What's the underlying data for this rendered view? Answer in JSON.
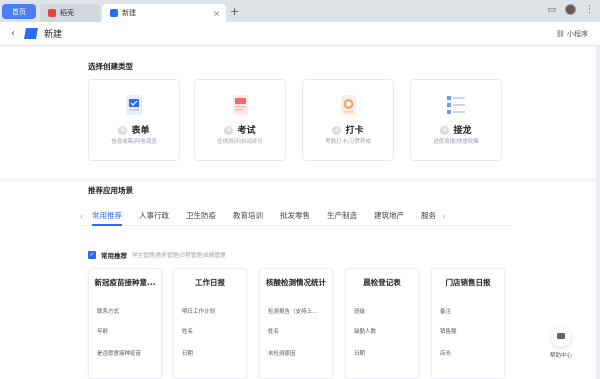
{
  "browser": {
    "tabs": [
      {
        "label": "首页"
      },
      {
        "label": "稻壳"
      },
      {
        "label": "新建"
      }
    ],
    "add_tab": "+",
    "close": "×"
  },
  "header": {
    "back": "‹",
    "title": "新建",
    "mini_program": "小程序"
  },
  "create_section": {
    "title": "选择创建类型",
    "types": [
      {
        "name": "表单",
        "desc": "信息收集|问卷调查",
        "icon": "form-icon"
      },
      {
        "name": "考试",
        "desc": "在线测评|自动评分",
        "icon": "exam-icon"
      },
      {
        "name": "打卡",
        "desc": "考勤打卡|习惯养成",
        "icon": "checkin-icon"
      },
      {
        "name": "接龙",
        "desc": "进度填报|快速收集",
        "icon": "relay-icon"
      }
    ]
  },
  "recommend_section": {
    "title": "推荐应用场景",
    "categories": [
      "常用推荐",
      "人事行政",
      "卫生防疫",
      "教育培训",
      "批发零售",
      "生产制造",
      "建筑地产",
      "服务"
    ],
    "active_category": "常用推荐",
    "subheading": "常用推荐",
    "subtext": "学生管理|教务管理|日程管理|成绩管理",
    "templates": [
      {
        "title": "新冠疫苗接种意...",
        "fields": [
          "联系方式",
          "年龄",
          "是否愿意接种疫苗"
        ]
      },
      {
        "title": "工作日报",
        "fields": [
          "明日工作计划",
          "姓名",
          "日期"
        ]
      },
      {
        "title": "核酸检测情况统计",
        "fields": [
          "检测报告（支持上...",
          "姓名",
          "未检测原因"
        ]
      },
      {
        "title": "晨检登记表",
        "fields": [
          "班级",
          "缺勤人数",
          "日期"
        ]
      },
      {
        "title": "门店销售日报",
        "fields": [
          "备注",
          "销售额",
          "店长"
        ]
      }
    ]
  },
  "help": {
    "label": "帮助中心"
  },
  "colors": {
    "accent": "#2c6cf0",
    "home_tab": "#4a7ef5"
  }
}
